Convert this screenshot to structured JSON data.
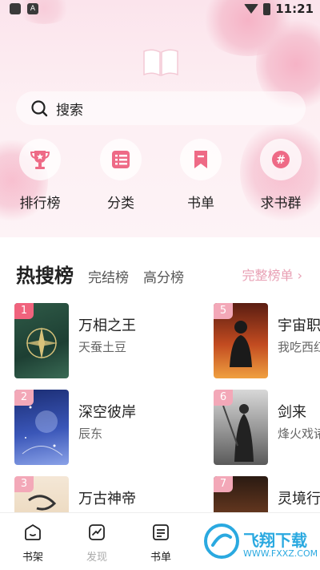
{
  "status_bar": {
    "time": "11:21"
  },
  "search": {
    "label": "搜索"
  },
  "categories": [
    {
      "label": "排行榜",
      "icon": "trophy-icon"
    },
    {
      "label": "分类",
      "icon": "list-icon"
    },
    {
      "label": "书单",
      "icon": "bookmark-icon"
    },
    {
      "label": "求书群",
      "icon": "hashtag-icon"
    }
  ],
  "rank_tabs": {
    "hot": "热搜榜",
    "finished": "完结榜",
    "high_score": "高分榜",
    "full_list": "完整榜单 ›"
  },
  "books": [
    {
      "rank": "1",
      "title": "万相之王",
      "author": "天蚕土豆"
    },
    {
      "rank": "2",
      "title": "深空彼岸",
      "author": "辰东"
    },
    {
      "rank": "3",
      "title": "万古神帝",
      "author": ""
    },
    {
      "rank": "5",
      "title": "宇宙职",
      "author": "我吃西红"
    },
    {
      "rank": "6",
      "title": "剑来",
      "author": "烽火戏诸"
    },
    {
      "rank": "7",
      "title": "灵境行",
      "author": ""
    }
  ],
  "tabbar": [
    {
      "label": "书架",
      "icon": "bookshelf-icon"
    },
    {
      "label": "发现",
      "icon": "discover-icon"
    },
    {
      "label": "书单",
      "icon": "booklist-icon"
    }
  ],
  "watermark": {
    "text": "飞翔下载",
    "url": "WWW.FXXZ.COM"
  },
  "colors": {
    "accent": "#e8a0b4",
    "badge_top": "#f0637d",
    "badge": "#f3a8b8",
    "watermark": "#2aa9e0"
  }
}
